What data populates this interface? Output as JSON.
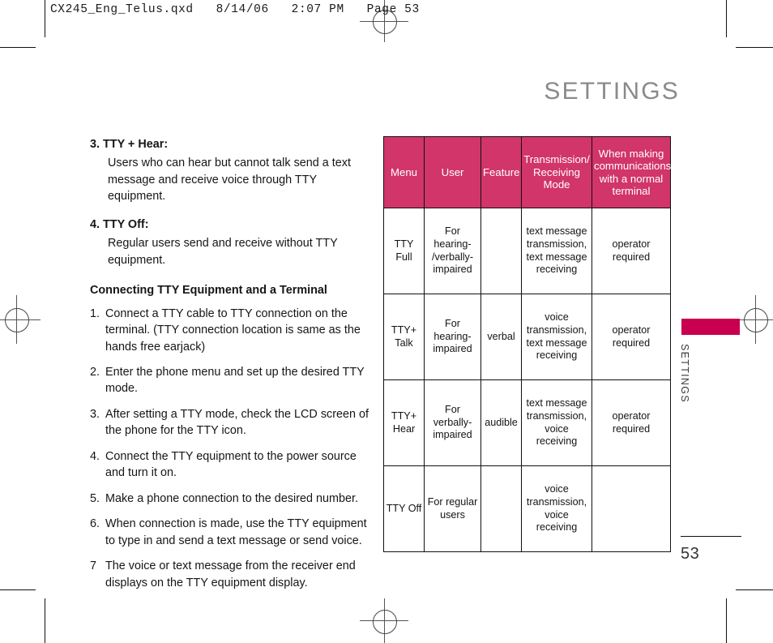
{
  "prepress": {
    "header_line": "CX245_Eng_Telus.qxd   8/14/06   2:07 PM   Page 53"
  },
  "page": {
    "title": "SETTINGS",
    "folio": "53",
    "side_label": "SETTINGS",
    "accent_color": "#d1356a",
    "tab_color": "#c8004f",
    "title_color": "#8a8a8a"
  },
  "content": {
    "item3": {
      "heading": "3. TTY + Hear:",
      "body": "Users who can hear but cannot talk send a text message and receive voice through TTY equipment."
    },
    "item4": {
      "heading": "4. TTY Off:",
      "body": "Regular users send and receive without TTY equipment."
    },
    "section_heading": "Connecting TTY Equipment and a Terminal",
    "steps": [
      {
        "num": "1.",
        "text": "Connect a TTY cable to TTY connection on the terminal. (TTY connection location is same as the hands free earjack)"
      },
      {
        "num": "2.",
        "text": "Enter the phone menu and set up the desired TTY mode."
      },
      {
        "num": "3.",
        "text": "After setting a TTY mode, check the LCD screen of the phone for the TTY icon."
      },
      {
        "num": "4.",
        "text": "Connect the TTY equipment to the power source and turn it on."
      },
      {
        "num": "5.",
        "text": "Make a phone connection to the desired number."
      },
      {
        "num": "6.",
        "text": "When connection is made, use the TTY equipment to type in and send a text message or send voice."
      },
      {
        "num": "7",
        "text": "The voice or text message from the receiver end displays on the TTY equipment display."
      }
    ]
  },
  "table": {
    "headers": [
      "Menu",
      "User",
      "Feature",
      "Transmission/ Receiving Mode",
      "When making communications with a normal terminal"
    ],
    "rows": [
      {
        "menu": "TTY Full",
        "user": "For hearing- /verbally- impaired",
        "feature": "",
        "mode": "text message transmission, text message receiving",
        "normal": "operator required"
      },
      {
        "menu": "TTY+ Talk",
        "user": "For hearing- impaired",
        "feature": "verbal",
        "mode": "voice transmission, text message receiving",
        "normal": "operator required"
      },
      {
        "menu": "TTY+ Hear",
        "user": "For verbally- impaired",
        "feature": "audible",
        "mode": "text message transmission, voice receiving",
        "normal": "operator required"
      },
      {
        "menu": "TTY Off",
        "user": "For regular users",
        "feature": "",
        "mode": "voice transmission, voice receiving",
        "normal": ""
      }
    ]
  }
}
